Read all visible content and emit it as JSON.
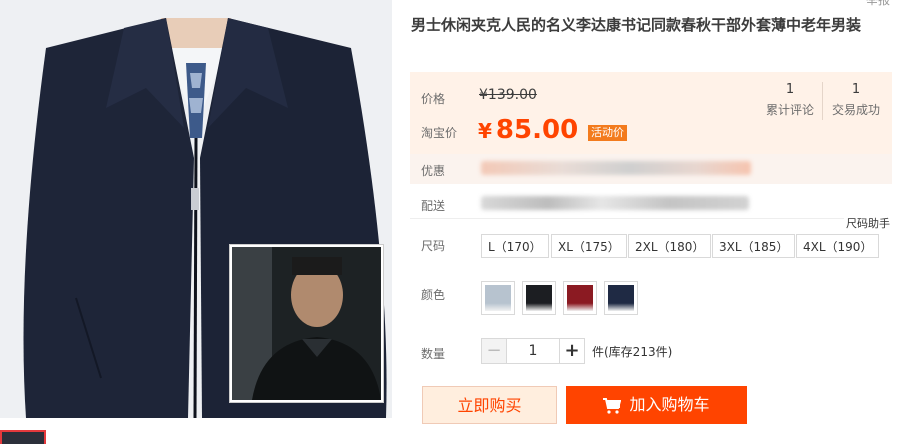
{
  "product": {
    "title": "男士休闲夹克人民的名义李达康书记同款春秋干部外套薄中老年男装"
  },
  "report_link": "举报",
  "price": {
    "label": "价格",
    "original": "¥139.00",
    "promo_label": "淘宝价",
    "currency": "¥",
    "current": "85.00",
    "promo_tag": "活动价"
  },
  "stats": {
    "reviews": {
      "value": "1",
      "label": "累计评论"
    },
    "sales": {
      "value": "1",
      "label": "交易成功"
    }
  },
  "discount": {
    "label": "优惠"
  },
  "delivery": {
    "label": "配送"
  },
  "size_helper": "尺码助手",
  "sizes": {
    "label": "尺码",
    "options": [
      "L（170）",
      "XL（175）",
      "2XL（180）",
      "3XL（185）",
      "4XL（190）"
    ]
  },
  "colors": {
    "label": "颜色",
    "swatches": [
      "#b7c3cf",
      "#1c1e22",
      "#8b1a22",
      "#1f2a44"
    ]
  },
  "quantity": {
    "label": "数量",
    "value": "1",
    "minus": "−",
    "plus": "+",
    "stock": "件(库存213件)"
  },
  "actions": {
    "buy_now": "立即购买",
    "add_to_cart": "加入购物车"
  },
  "theme": {
    "accent": "#ff4400",
    "price_bg": "#fff2e8"
  }
}
